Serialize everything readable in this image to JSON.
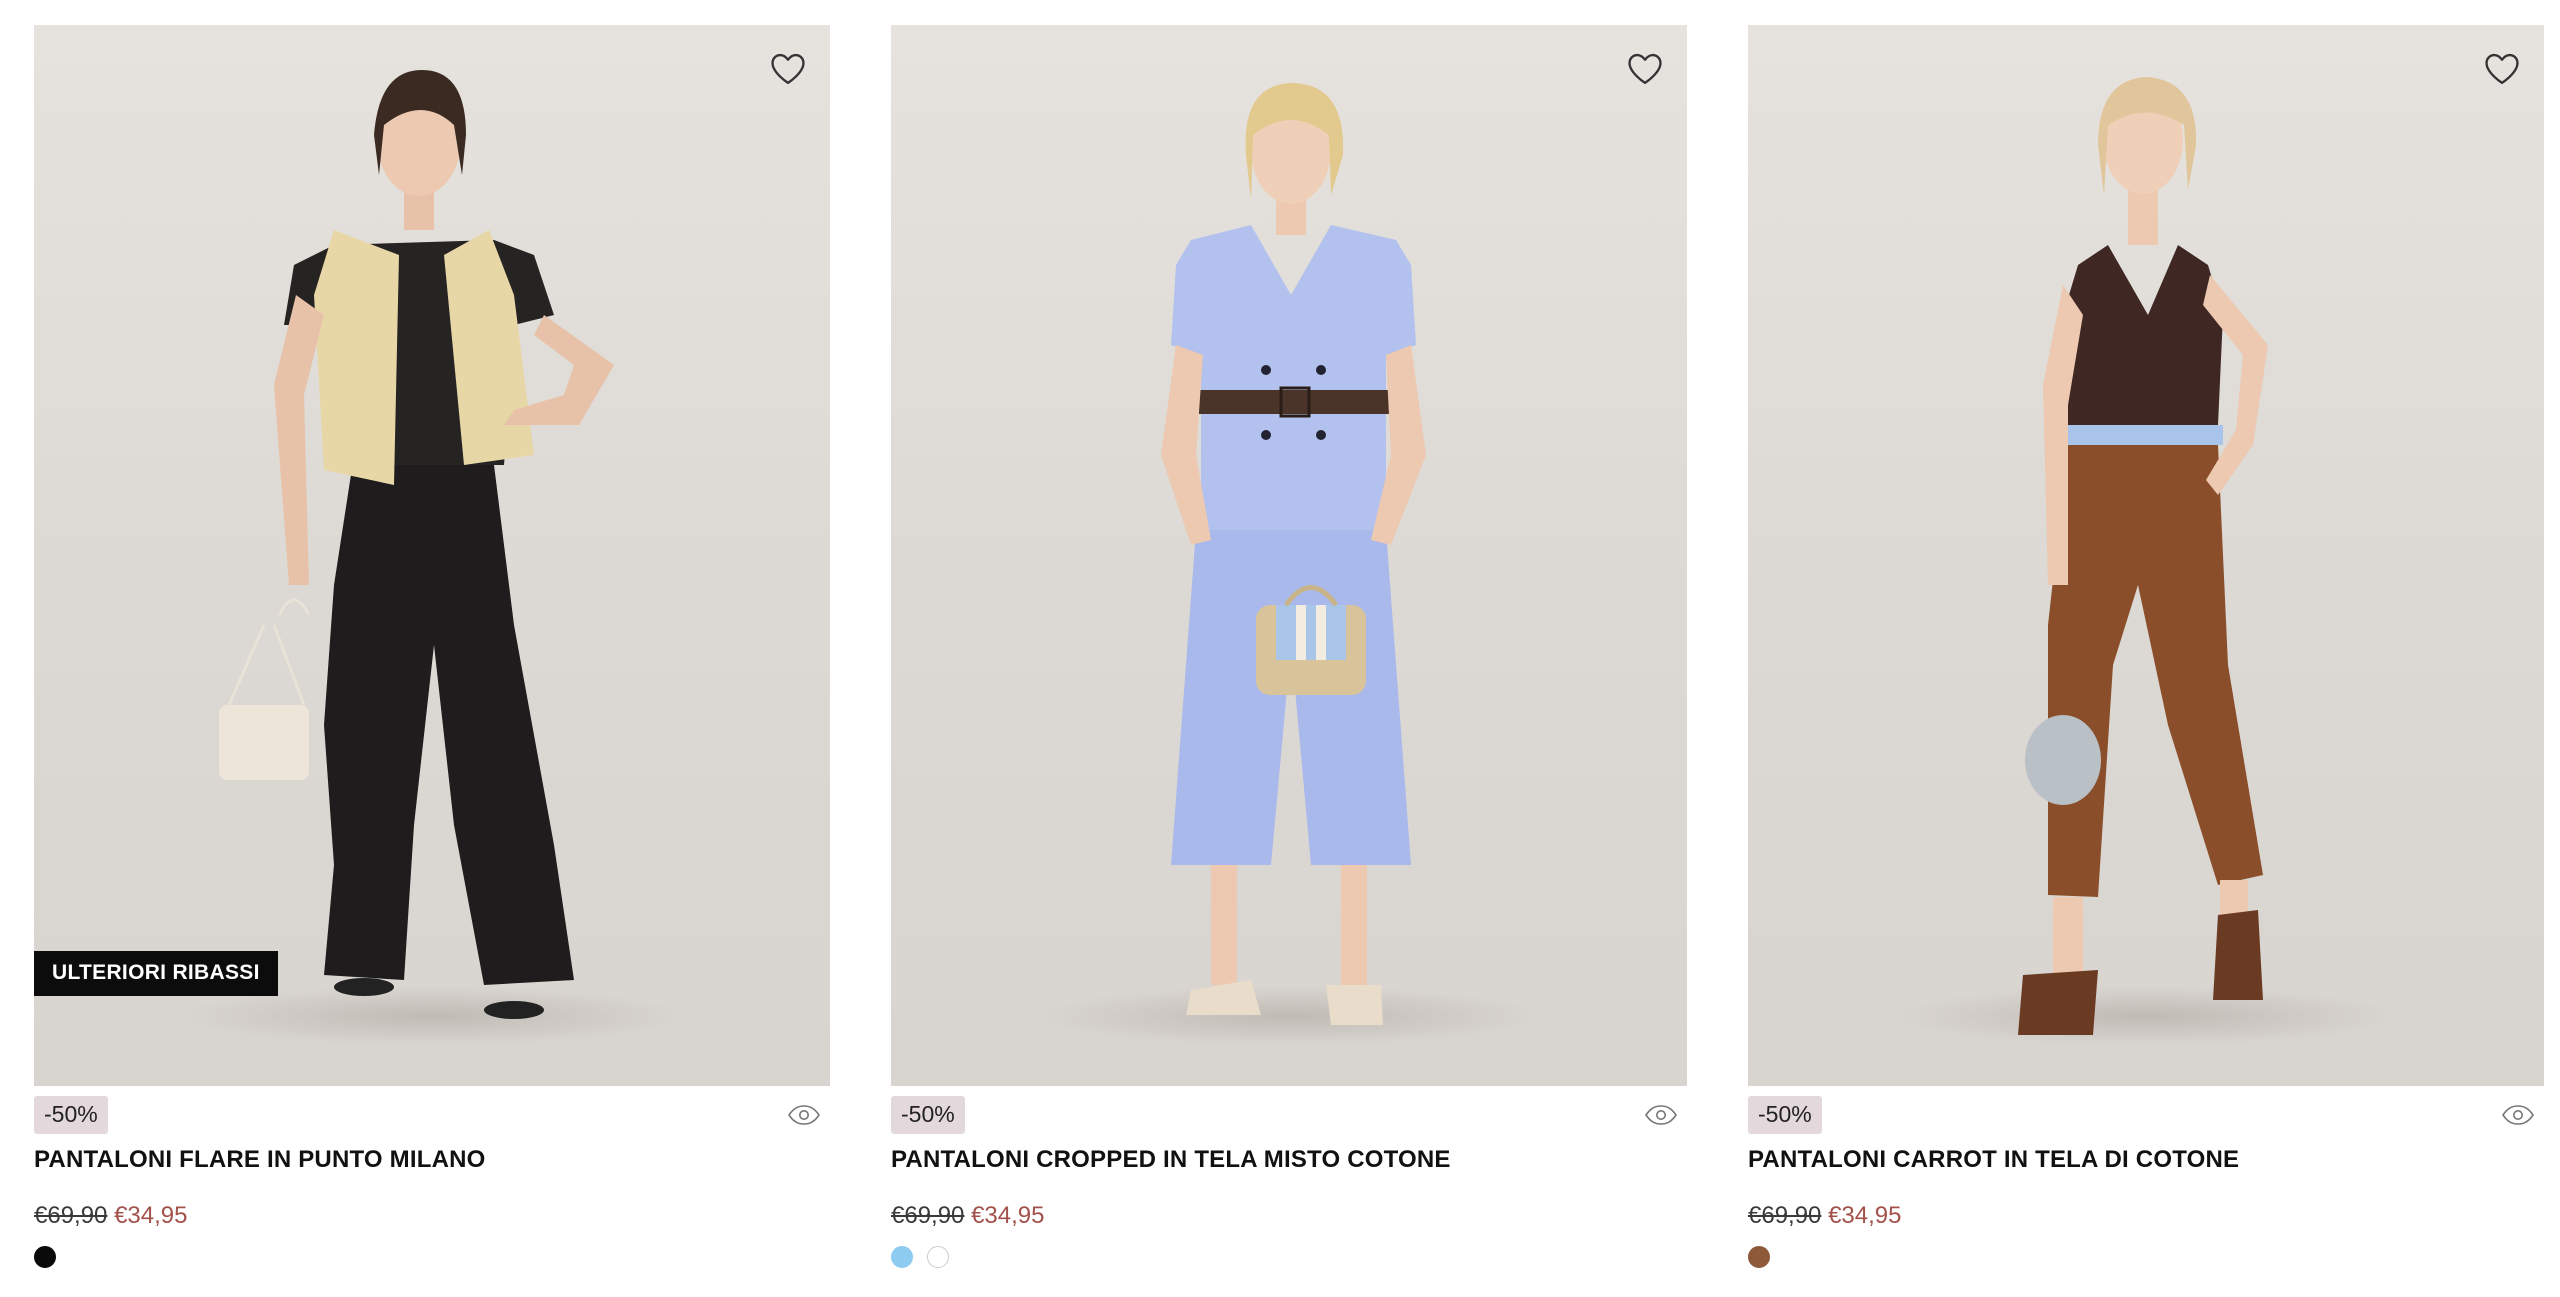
{
  "products": [
    {
      "name": "PANTALONI FLARE IN PUNTO MILANO",
      "badge": "ULTERIORI RIBASSI",
      "discount": "-50%",
      "old_price": "€69,90",
      "new_price": "€34,95",
      "swatches": [
        {
          "color": "#0a0a0a",
          "border": "#0a0a0a"
        }
      ],
      "icons": {
        "wishlist": "heart-outline-icon",
        "quick_view": "eye-icon"
      }
    },
    {
      "name": "PANTALONI CROPPED IN TELA MISTO COTONE",
      "badge": "",
      "discount": "-50%",
      "old_price": "€69,90",
      "new_price": "€34,95",
      "swatches": [
        {
          "color": "#8ecbf0",
          "border": "#8ecbf0"
        },
        {
          "color": "#ffffff",
          "border": "#cccccc"
        }
      ],
      "icons": {
        "wishlist": "heart-outline-icon",
        "quick_view": "eye-icon"
      }
    },
    {
      "name": "PANTALONI CARROT IN TELA DI COTONE",
      "badge": "",
      "discount": "-50%",
      "old_price": "€69,90",
      "new_price": "€34,95",
      "swatches": [
        {
          "color": "#8c5a38",
          "border": "#8c5a38"
        }
      ],
      "icons": {
        "wishlist": "heart-outline-icon",
        "quick_view": "eye-icon"
      }
    }
  ],
  "colors": {
    "sale_price": "#a3514b",
    "discount_bg": "#e3d8dc",
    "badge_bg": "#0c0c0c"
  }
}
